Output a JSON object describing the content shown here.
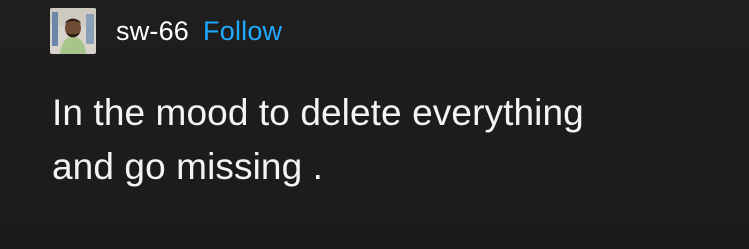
{
  "post": {
    "author": {
      "username": "sw-66",
      "avatar_icon": "user-avatar-photo"
    },
    "follow_label": "Follow",
    "text_lines": [
      "In the mood to delete everything",
      "and go missing ."
    ]
  },
  "colors": {
    "background": "#1c1c1c",
    "text": "#f4f4f4",
    "follow_accent": "#1fa9ff"
  }
}
